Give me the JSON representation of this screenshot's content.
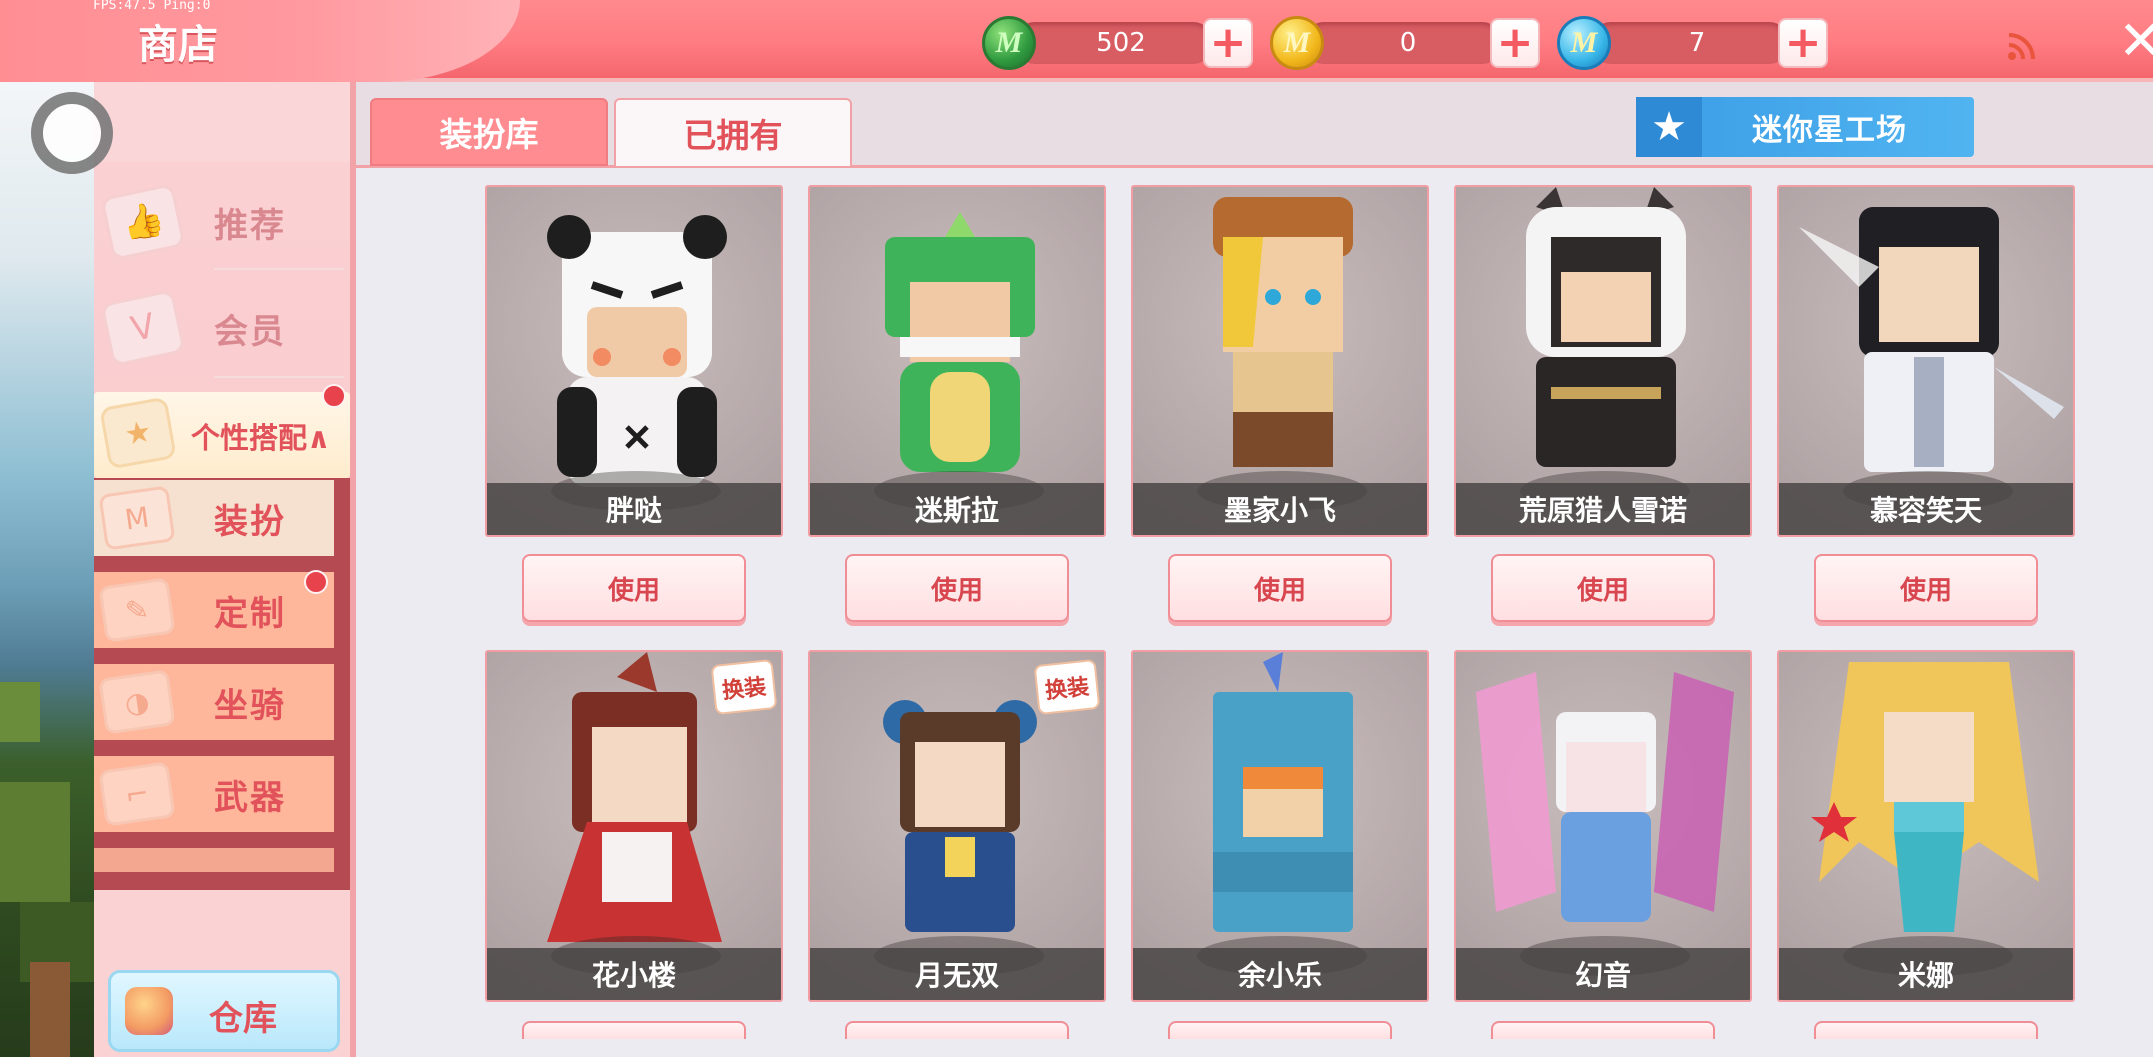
{
  "debug": {
    "fps_text": "FPS:47.5  Ping:0"
  },
  "header": {
    "title": "商店",
    "currencies": [
      {
        "name": "mini-bean",
        "icon": "green-gem-icon",
        "letter": "M",
        "value": "502"
      },
      {
        "name": "mini-coin",
        "icon": "gold-coin-icon",
        "letter": "M",
        "value": "0"
      },
      {
        "name": "star-coin",
        "icon": "blue-coin-icon",
        "letter": "M",
        "value": "7"
      }
    ],
    "plus_label": "+",
    "close_label": "✕"
  },
  "sidebar": {
    "items": [
      {
        "label": "推荐",
        "icon": "thumbs-up-icon"
      },
      {
        "label": "会员",
        "icon": "vip-card-icon"
      }
    ],
    "expanded": {
      "label": "个性搭配∧",
      "icon": "badge-icon",
      "has_dot": true
    },
    "sub_items": [
      {
        "label": "装扮",
        "icon": "shirt-icon",
        "active": true,
        "has_dot": false
      },
      {
        "label": "定制",
        "icon": "pencil-icon",
        "active": false,
        "has_dot": true
      },
      {
        "label": "坐骑",
        "icon": "mount-icon",
        "active": false,
        "has_dot": false
      },
      {
        "label": "武器",
        "icon": "gun-icon",
        "active": false,
        "has_dot": false
      }
    ],
    "warehouse": {
      "label": "仓库",
      "icon": "chest-icon"
    }
  },
  "tabs": {
    "wardrobe": "装扮库",
    "owned": "已拥有",
    "active": "owned"
  },
  "workshop_button": {
    "label": "迷你星工场",
    "icon": "star-icon"
  },
  "skins": [
    {
      "name": "胖哒",
      "button": "使用",
      "swap_badge": ""
    },
    {
      "name": "迷斯拉",
      "button": "使用",
      "swap_badge": ""
    },
    {
      "name": "墨家小飞",
      "button": "使用",
      "swap_badge": ""
    },
    {
      "name": "荒原猎人雪诺",
      "button": "使用",
      "swap_badge": ""
    },
    {
      "name": "慕容笑天",
      "button": "使用",
      "swap_badge": ""
    },
    {
      "name": "花小楼",
      "button": "",
      "swap_badge": "换装"
    },
    {
      "name": "月无双",
      "button": "",
      "swap_badge": "换装"
    },
    {
      "name": "余小乐",
      "button": "",
      "swap_badge": ""
    },
    {
      "name": "幻音",
      "button": "",
      "swap_badge": ""
    },
    {
      "name": "米娜",
      "button": "",
      "swap_badge": ""
    }
  ],
  "colors": {
    "header_bg": "#ff7c82",
    "accent_red": "#e2525a",
    "workshop_blue": "#3b9de5",
    "name_bar": "#464242"
  }
}
